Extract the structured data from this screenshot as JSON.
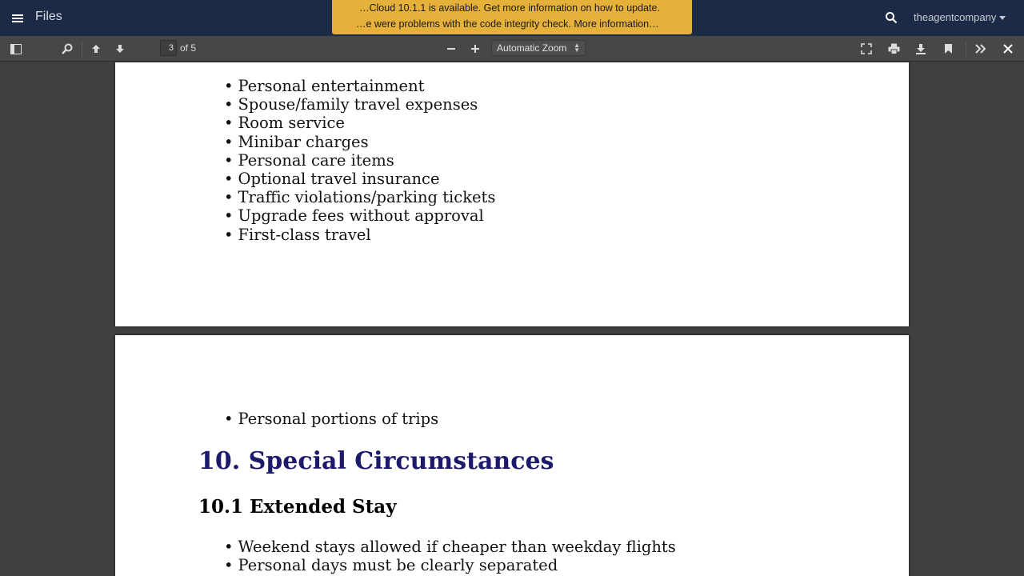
{
  "header": {
    "app_title": "Files",
    "notice_line1": "…Cloud 10.1.1 is available. Get more information on how to update.",
    "notice_line2": "…e were problems with the code integrity check. More information…",
    "user_label": "theagentcompany"
  },
  "toolbar": {
    "page_number": "3",
    "page_count": "of 5",
    "zoom_value": "Automatic Zoom"
  },
  "document": {
    "page1_bullets": [
      "Personal entertainment",
      "Spouse/family travel expenses",
      "Room service",
      "Minibar charges",
      "Personal care items",
      "Optional travel insurance",
      "Traffic violations/parking tickets",
      "Upgrade fees without approval",
      "First-class travel"
    ],
    "page2_bullet_top": "Personal portions of trips",
    "section_heading": "10. Special Circumstances",
    "subsection_heading": "10.1 Extended Stay",
    "page2_bullets": [
      "Weekend stays allowed if cheaper than weekday flights",
      "Personal days must be clearly separated"
    ]
  },
  "icons": {
    "menu": "hamburger-icon",
    "search": "search-icon",
    "sidebar": "sidebar-toggle-icon",
    "find": "find-icon",
    "prev": "page-up-icon",
    "next": "page-down-icon",
    "zoom_out": "minus-icon",
    "zoom_in": "plus-icon",
    "presentation": "fullscreen-icon",
    "print": "print-icon",
    "download": "download-icon",
    "bookmark": "bookmark-icon",
    "tools": "double-chevron-icon",
    "close": "close-icon"
  },
  "colors": {
    "header_bg": "#1c2a45",
    "notice_bg": "#e5b13a",
    "heading_color": "#1e1a6b"
  }
}
